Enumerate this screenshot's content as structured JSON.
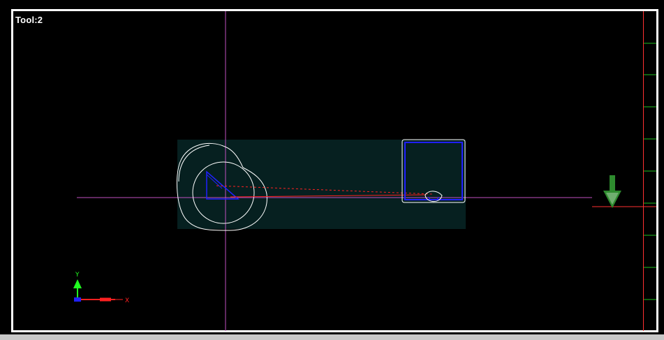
{
  "viewport": {
    "tool_label": "Tool:2"
  },
  "axes_indicator": {
    "y_label": "Y",
    "x_label": "X"
  },
  "colors": {
    "background": "#000000",
    "frame": "#ffffff",
    "stock_fill": "#062020",
    "crosshair": "#c050c0",
    "part_outline": "#ffffff",
    "tool_path": "#2020ff",
    "rapid_move": "#ff2020",
    "ruler_line": "#ff3030",
    "ruler_ticks": "#20c020",
    "tool_arrow": "#2e8b2e",
    "axis_y": "#20ff20",
    "axis_x": "#ff2020",
    "axis_origin": "#2020ff"
  },
  "icons": {
    "tool_marker": "down-arrow-icon",
    "axes_gizmo": "xy-axes-icon"
  }
}
